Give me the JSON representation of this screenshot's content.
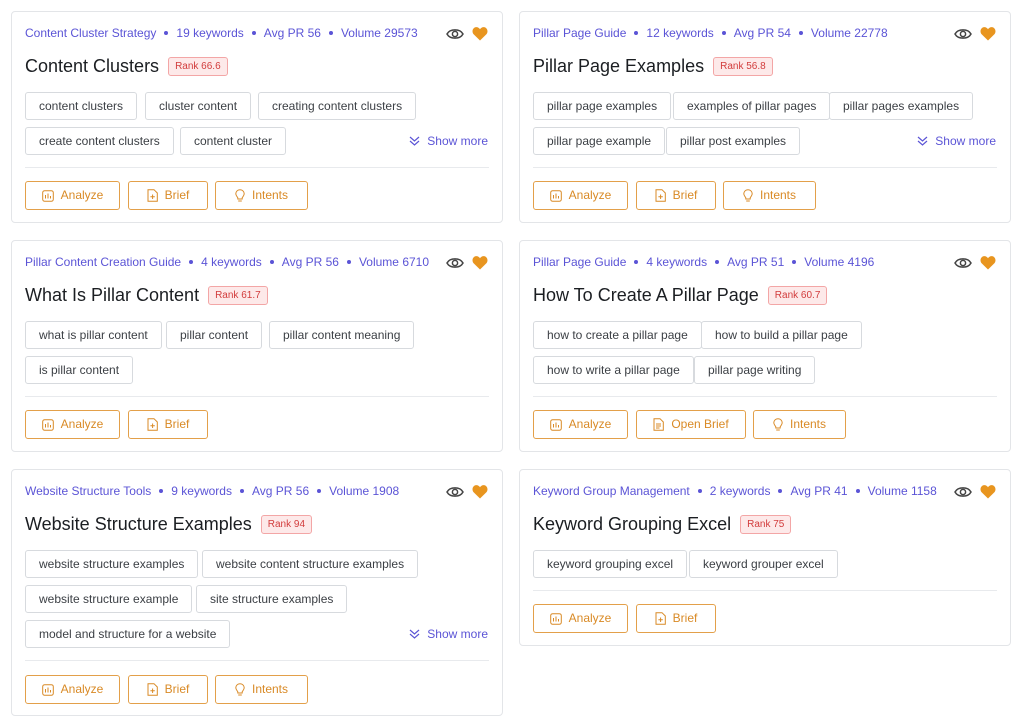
{
  "colors": {
    "accent": "#5b54d6",
    "orange": "#e0962e",
    "rank_red": "#d23c3c"
  },
  "actions": {
    "analyze": "Analyze",
    "brief": "Brief",
    "open_brief": "Open Brief",
    "intents": "Intents",
    "show_more": "Show more"
  },
  "cards": [
    {
      "category": "Content Cluster Strategy",
      "keywords": "19 keywords",
      "avg_pr": "Avg PR 56",
      "volume": "Volume 29573",
      "title": "Content Clusters",
      "rank": "Rank 66.6",
      "tags": [
        "content clusters",
        "cluster content",
        "creating content clusters",
        "create content clusters",
        "content cluster"
      ]
    },
    {
      "category": "Pillar Page Guide",
      "keywords": "12 keywords",
      "avg_pr": "Avg PR 54",
      "volume": "Volume 22778",
      "title": "Pillar Page Examples",
      "rank": "Rank 56.8",
      "tags": [
        "pillar page examples",
        "examples of pillar pages",
        "pillar pages examples",
        "pillar page example",
        "pillar post examples"
      ]
    },
    {
      "category": "Pillar Content Creation Guide",
      "keywords": "4 keywords",
      "avg_pr": "Avg PR 56",
      "volume": "Volume 6710",
      "title": "What Is Pillar Content",
      "rank": "Rank 61.7",
      "tags": [
        "what is pillar content",
        "pillar content",
        "pillar content meaning",
        "is pillar content"
      ]
    },
    {
      "category": "Pillar Page Guide",
      "keywords": "4 keywords",
      "avg_pr": "Avg PR 51",
      "volume": "Volume 4196",
      "title": "How To Create A Pillar Page",
      "rank": "Rank 60.7",
      "tags": [
        "how to create a pillar page",
        "how to build a pillar page",
        "how to write a pillar page",
        "pillar page writing"
      ]
    },
    {
      "category": "Website Structure Tools",
      "keywords": "9 keywords",
      "avg_pr": "Avg PR 56",
      "volume": "Volume 1908",
      "title": "Website Structure Examples",
      "rank": "Rank 94",
      "tags": [
        "website structure examples",
        "website content structure examples",
        "website structure example",
        "site structure examples",
        "model and structure for a website"
      ]
    },
    {
      "category": "Keyword Group Management",
      "keywords": "2 keywords",
      "avg_pr": "Avg PR 41",
      "volume": "Volume 1158",
      "title": "Keyword Grouping Excel",
      "rank": "Rank 75",
      "tags": [
        "keyword grouping excel",
        "keyword grouper excel"
      ]
    }
  ]
}
